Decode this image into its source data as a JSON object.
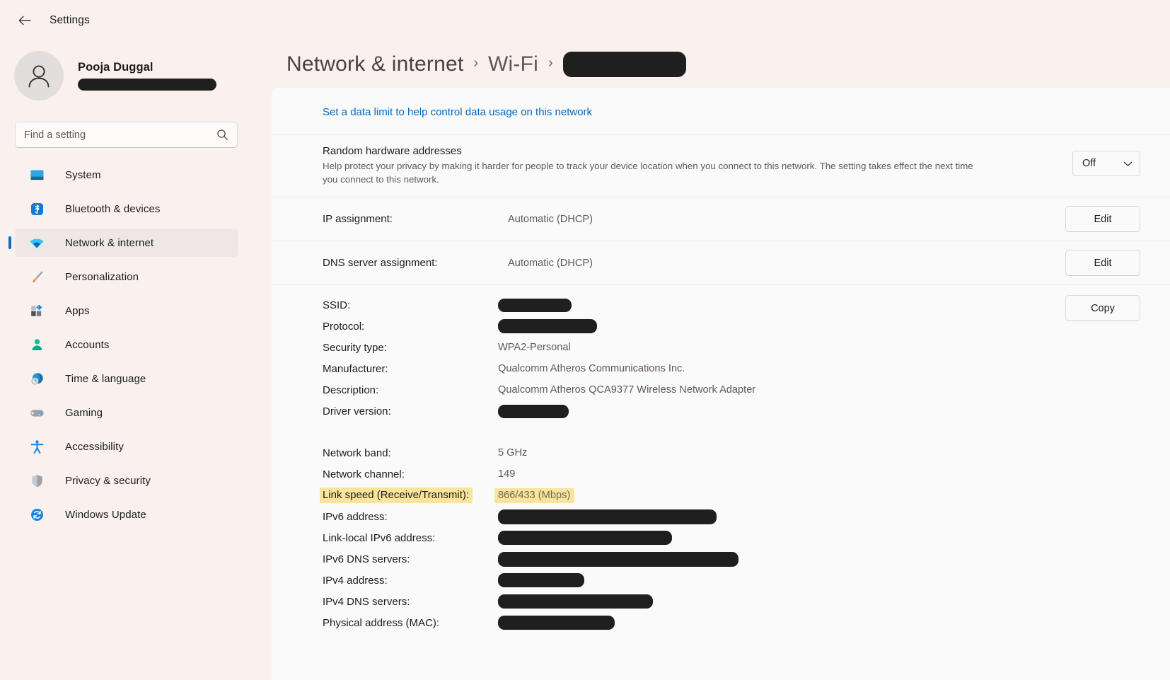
{
  "window": {
    "title": "Settings",
    "back_icon": "back-arrow-icon"
  },
  "account": {
    "name": "Pooja Duggal",
    "email_redacted": true,
    "avatar_icon": "person-avatar-icon"
  },
  "search": {
    "placeholder": "Find a setting",
    "value": "",
    "icon": "search-icon"
  },
  "sidebar": {
    "items": [
      {
        "label": "System",
        "icon": "monitor-icon",
        "selected": false
      },
      {
        "label": "Bluetooth & devices",
        "icon": "bluetooth-icon",
        "selected": false
      },
      {
        "label": "Network & internet",
        "icon": "wifi-icon",
        "selected": true
      },
      {
        "label": "Personalization",
        "icon": "paintbrush-icon",
        "selected": false
      },
      {
        "label": "Apps",
        "icon": "apps-icon",
        "selected": false
      },
      {
        "label": "Accounts",
        "icon": "account-person-icon",
        "selected": false
      },
      {
        "label": "Time & language",
        "icon": "clock-globe-icon",
        "selected": false
      },
      {
        "label": "Gaming",
        "icon": "gamepad-icon",
        "selected": false
      },
      {
        "label": "Accessibility",
        "icon": "accessibility-person-icon",
        "selected": false
      },
      {
        "label": "Privacy & security",
        "icon": "shield-icon",
        "selected": false
      },
      {
        "label": "Windows Update",
        "icon": "refresh-circle-icon",
        "selected": false
      }
    ]
  },
  "breadcrumb": {
    "items": [
      "Network & internet",
      "Wi-Fi"
    ],
    "separator": "›",
    "current_redacted": true
  },
  "main": {
    "data_limit_link": "Set a data limit to help control data usage on this network",
    "random_hw": {
      "title": "Random hardware addresses",
      "description": "Help protect your privacy by making it harder for people to track your device location when you connect to this network. The setting takes effect the next time you connect to this network.",
      "dropdown_value": "Off",
      "dropdown_icon": "chevron-down-icon"
    },
    "ip_assignment": {
      "key": "IP assignment:",
      "value": "Automatic (DHCP)",
      "button": "Edit"
    },
    "dns_assignment": {
      "key": "DNS server assignment:",
      "value": "Automatic (DHCP)",
      "button": "Edit"
    },
    "copy_button": "Copy",
    "details_group_1": [
      {
        "key": "SSID:",
        "value": "",
        "redacted": true,
        "redact_class": "r-ssid"
      },
      {
        "key": "Protocol:",
        "value": "",
        "redacted": true,
        "redact_class": "r-proto"
      },
      {
        "key": "Security type:",
        "value": "WPA2-Personal",
        "redacted": false
      },
      {
        "key": "Manufacturer:",
        "value": "Qualcomm Atheros Communications Inc.",
        "redacted": false
      },
      {
        "key": "Description:",
        "value": "Qualcomm Atheros QCA9377 Wireless Network Adapter",
        "redacted": false
      },
      {
        "key": "Driver version:",
        "value": "",
        "redacted": true,
        "redact_class": "r-driver"
      }
    ],
    "details_group_2": [
      {
        "key": "Network band:",
        "value": "5 GHz",
        "redacted": false,
        "highlight": false
      },
      {
        "key": "Network channel:",
        "value": "149",
        "redacted": false,
        "highlight": false
      },
      {
        "key": "Link speed (Receive/Transmit):",
        "value": "866/433 (Mbps)",
        "redacted": false,
        "highlight": true
      },
      {
        "key": "IPv6 address:",
        "value": "",
        "redacted": true,
        "redact_class": "r-ipv6",
        "highlight": false
      },
      {
        "key": "Link-local IPv6 address:",
        "value": "",
        "redacted": true,
        "redact_class": "r-ll",
        "highlight": false
      },
      {
        "key": "IPv6 DNS servers:",
        "value": "",
        "redacted": true,
        "redact_class": "r-ipv6dns",
        "highlight": false
      },
      {
        "key": "IPv4 address:",
        "value": "",
        "redacted": true,
        "redact_class": "r-ipv4",
        "highlight": false
      },
      {
        "key": "IPv4 DNS servers:",
        "value": "",
        "redacted": true,
        "redact_class": "r-ipv4dns",
        "highlight": false
      },
      {
        "key": "Physical address (MAC):",
        "value": "",
        "redacted": true,
        "redact_class": "r-mac",
        "highlight": false
      }
    ]
  },
  "colors": {
    "accent": "#0f6cbd",
    "link": "#0067c0",
    "highlight": "#f9e49b",
    "sidebar_bg": "#faf1ef",
    "panel_bg": "#fbfafa",
    "redaction": "#1f1f1f"
  }
}
